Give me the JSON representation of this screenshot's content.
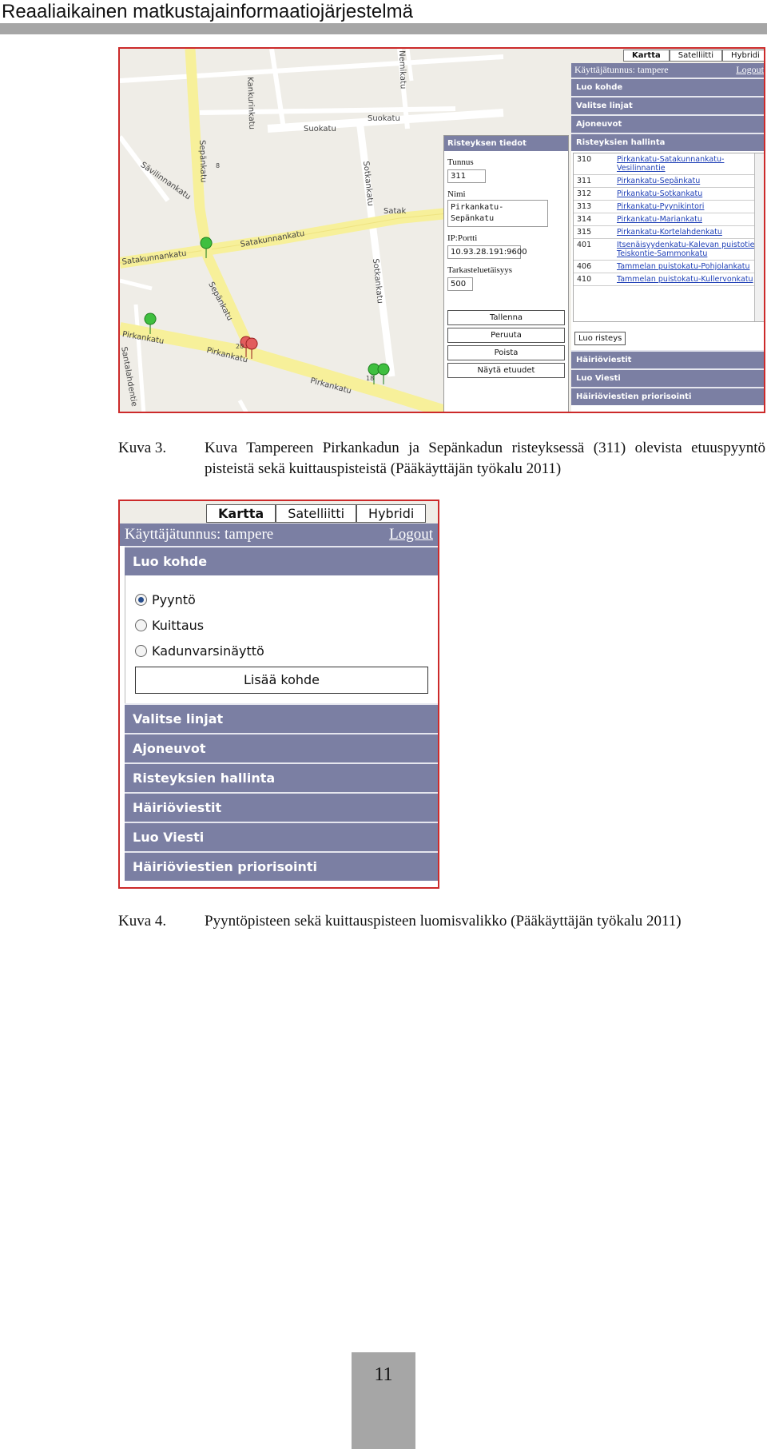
{
  "header": {
    "title": "Reaaliaikainen matkustajainformaatiojärjestelmä"
  },
  "figure1": {
    "map_types": [
      "Kartta",
      "Satelliitti",
      "Hybridi"
    ],
    "active_map_type": "Kartta",
    "street_labels": {
      "kankurinkatu": "Kankurinkatu",
      "suokatu_1": "Suokatu",
      "suokatu_2": "Suokatu",
      "sepankatu_1": "Sepänkatu",
      "savilinnankatu": "Sävilinnankatu",
      "satakunnankatu_1": "Satakunnankatu",
      "satakunnankatu_2": "Satakunnankatu",
      "sepankatu_2": "Sepänkatu",
      "sotkankatu_1": "Sotkankatu",
      "sotkankatu_2": "Sotkankatu",
      "pirkankatu_1": "Pirkankatu",
      "pirkankatu_2": "Pirkankatu",
      "pirkankatu_3": "Pirkankatu",
      "satak": "Satak",
      "santalahdentie": "Santalahdentie",
      "nemikatu": "Nemikatu",
      "num_20": "20",
      "num_18": "18",
      "num_8": "8"
    },
    "panel": {
      "user_label": "Käyttäjätunnus: tampere",
      "logout": "Logout",
      "menu_top": [
        "Luo kohde",
        "Valitse linjat",
        "Ajoneuvot",
        "Risteyksien hallinta"
      ],
      "junctions": [
        {
          "id": "310",
          "name": "Pirkankatu-Satakunnankatu-Vesilinnantie"
        },
        {
          "id": "311",
          "name": "Pirkankatu-Sepänkatu"
        },
        {
          "id": "312",
          "name": "Pirkankatu-Sotkankatu"
        },
        {
          "id": "313",
          "name": "Pirkankatu-Pyynikintori"
        },
        {
          "id": "314",
          "name": "Pirkankatu-Mariankatu"
        },
        {
          "id": "315",
          "name": "Pirkankatu-Kortelahdenkatu"
        },
        {
          "id": "401",
          "name": "Itsenäisyydenkatu-Kalevan puistotie-Teiskontie-Sammonkatu"
        },
        {
          "id": "406",
          "name": "Tammelan puistokatu-Pohjolankatu"
        },
        {
          "id": "410",
          "name": "Tammelan puistokatu-Kullervonkatu"
        }
      ],
      "luo_risteys": "Luo risteys",
      "menu_bottom": [
        "Häiriöviestit",
        "Luo Viesti",
        "Häiriöviestien priorisointi"
      ]
    },
    "details": {
      "title": "Risteyksen tiedot",
      "tunnus_label": "Tunnus",
      "tunnus_value": "311",
      "nimi_label": "Nimi",
      "nimi_line1": "Pirkankatu-",
      "nimi_line2": "Sepänkatu",
      "ip_label": "IP:Portti",
      "ip_value": "10.93.28.191:9600",
      "accuracy_label": "Tarkasteluetäisyys",
      "accuracy_value": "500",
      "buttons": [
        "Tallenna",
        "Peruuta",
        "Poista",
        "Näytä etuudet"
      ]
    }
  },
  "caption1": {
    "number": "Kuva 3.",
    "text": "Kuva Tampereen Pirkankadun ja Sepänkadun risteyksessä (311) olevista etuuspyyntö pisteistä sekä kuittauspisteistä (Pääkäyttäjän työkalu 2011)"
  },
  "figure2": {
    "map_types": [
      "Kartta",
      "Satelliitti",
      "Hybridi"
    ],
    "user_label": "Käyttäjätunnus: tampere",
    "logout": "Logout",
    "luo_kohde": "Luo kohde",
    "options": [
      "Pyyntö",
      "Kuittaus",
      "Kadunvarsinäyttö"
    ],
    "selected_option": "Pyyntö",
    "add_button": "Lisää kohde",
    "menu": [
      "Valitse linjat",
      "Ajoneuvot",
      "Risteyksien hallinta",
      "Häiriöviestit",
      "Luo Viesti",
      "Häiriöviestien priorisointi"
    ]
  },
  "caption2": {
    "number": "Kuva 4.",
    "text": "Pyyntöpisteen sekä kuittauspisteen luomisvalikko (Pääkäyttäjän työkalu 2011)"
  },
  "footer": {
    "page_number": "11"
  }
}
